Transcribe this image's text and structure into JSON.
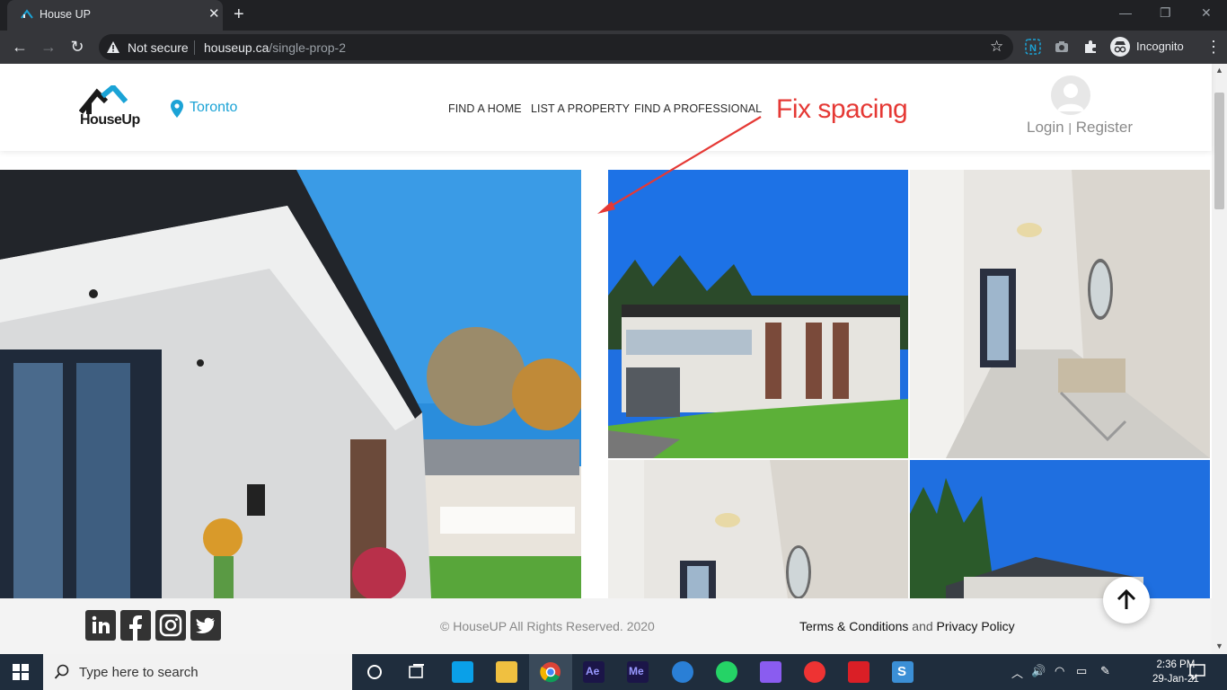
{
  "browser": {
    "tab_title": "House UP",
    "security_label": "Not secure",
    "url_host": "houseup.ca",
    "url_path": "/single-prop-2",
    "profile_label": "Incognito"
  },
  "site": {
    "logo_text": "HouseUp",
    "location": "Toronto",
    "nav": [
      "FIND A HOME",
      "LIST A PROPERTY",
      "FIND A PROFESSIONAL"
    ],
    "account": {
      "login": "Login",
      "separator": "|",
      "register": "Register"
    },
    "annotation": "Fix spacing"
  },
  "footer": {
    "social": [
      "linkedin-icon",
      "facebook-icon",
      "instagram-icon",
      "twitter-icon"
    ],
    "copyright": "© HouseUP All Rights Reserved. 2020",
    "terms": "Terms & Conditions",
    "and": "and",
    "privacy": "Privacy Policy"
  },
  "taskbar": {
    "search_placeholder": "Type here to search",
    "time": "2:36 PM",
    "date": "29-Jan-21"
  },
  "colors": {
    "accent_blue": "#1ba3d6",
    "annotation_red": "#e53935",
    "taskbar_bg": "#1f2d3d"
  }
}
